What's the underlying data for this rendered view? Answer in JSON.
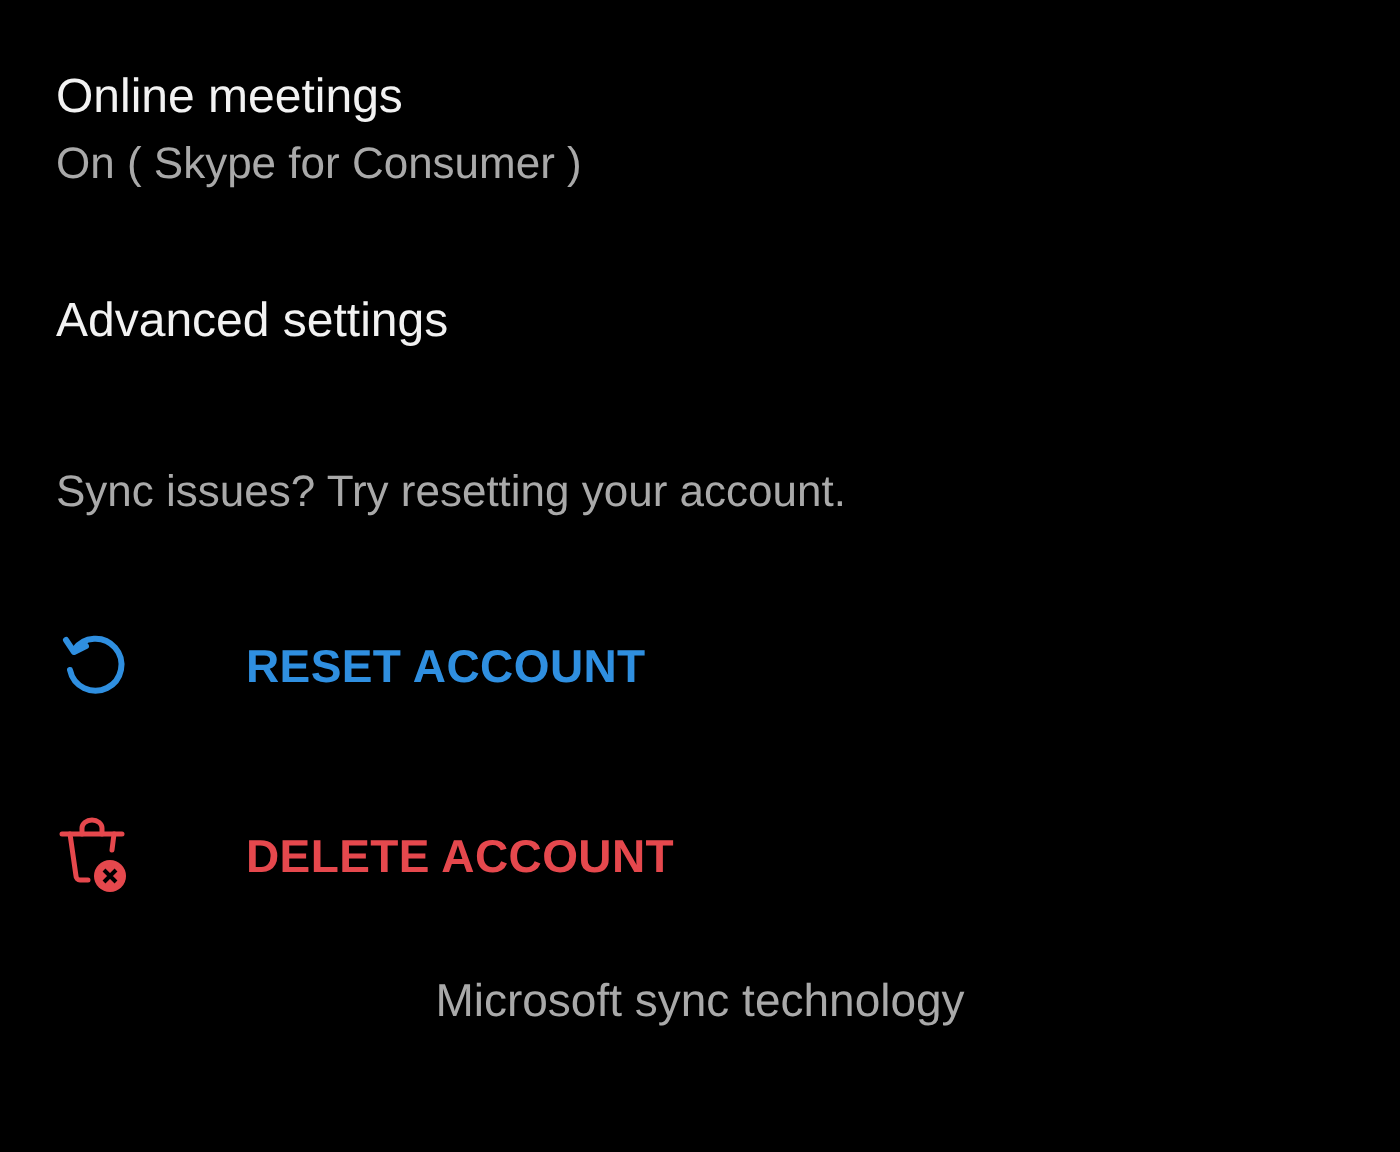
{
  "settings": [
    {
      "title": "Online meetings",
      "value": "On ( Skype for Consumer )"
    },
    {
      "title": "Advanced settings"
    }
  ],
  "sync_hint": "Sync issues? Try resetting your account.",
  "actions": [
    {
      "kind": "reset",
      "label": "RESET ACCOUNT",
      "color": "#2f8fe0"
    },
    {
      "kind": "delete",
      "label": "DELETE ACCOUNT",
      "color": "#e5484d"
    }
  ],
  "footer": "Microsoft sync technology"
}
